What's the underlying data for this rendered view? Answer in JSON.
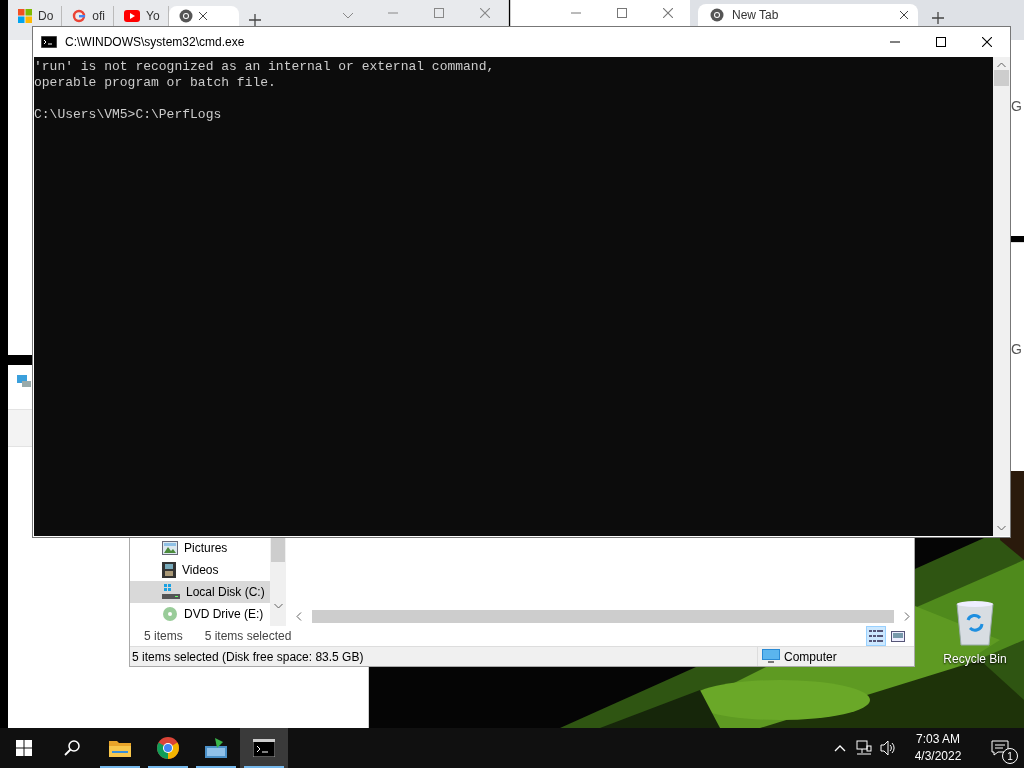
{
  "browser_window": {
    "tabs": [
      {
        "label": "Do",
        "selected": false
      },
      {
        "label": "ofi",
        "selected": false
      },
      {
        "label": "Yo",
        "selected": false
      },
      {
        "selected": true
      }
    ]
  },
  "new_tab_window": {
    "tabs": [
      {
        "label": "New Tab",
        "selected": true
      }
    ],
    "cut_text": "G"
  },
  "lower_browser_window": {
    "cut_text": "G"
  },
  "cmd_window": {
    "title": "C:\\WINDOWS\\system32\\cmd.exe",
    "output": [
      "'run' is not recognized as an internal or external command,",
      "operable program or batch file."
    ],
    "prompt": "C:\\Users\\VM5>C:\\PerfLogs"
  },
  "explorer_window": {
    "nav_items": [
      {
        "kind": "pictures",
        "label": "Pictures",
        "selected": false
      },
      {
        "kind": "videos",
        "label": "Videos",
        "selected": false
      },
      {
        "kind": "drive",
        "label": "Local Disk (C:)",
        "selected": true
      },
      {
        "kind": "dvd",
        "label": "DVD Drive (E:)",
        "selected": false
      }
    ],
    "item_count": "5 items",
    "selection_count": "5 items selected",
    "status_text": "5 items selected (Disk free space: 83.5 GB)",
    "location": "Computer",
    "views": [
      {
        "kind": "details",
        "selected": true
      },
      {
        "kind": "large_icons",
        "selected": false
      }
    ]
  },
  "desktop_icons": [
    {
      "kind": "recycle_bin",
      "label": "Recycle Bin"
    }
  ],
  "taskbar": {
    "apps": [
      {
        "kind": "search",
        "running": false,
        "selected": false
      },
      {
        "kind": "explorer",
        "running": true,
        "selected": false
      },
      {
        "kind": "browser",
        "running": true,
        "selected": false
      },
      {
        "kind": "installer",
        "running": true,
        "selected": false
      },
      {
        "kind": "terminal",
        "running": true,
        "selected": true
      }
    ],
    "time": "7:03 AM",
    "date": "4/3/2022",
    "notification_count": "1"
  }
}
